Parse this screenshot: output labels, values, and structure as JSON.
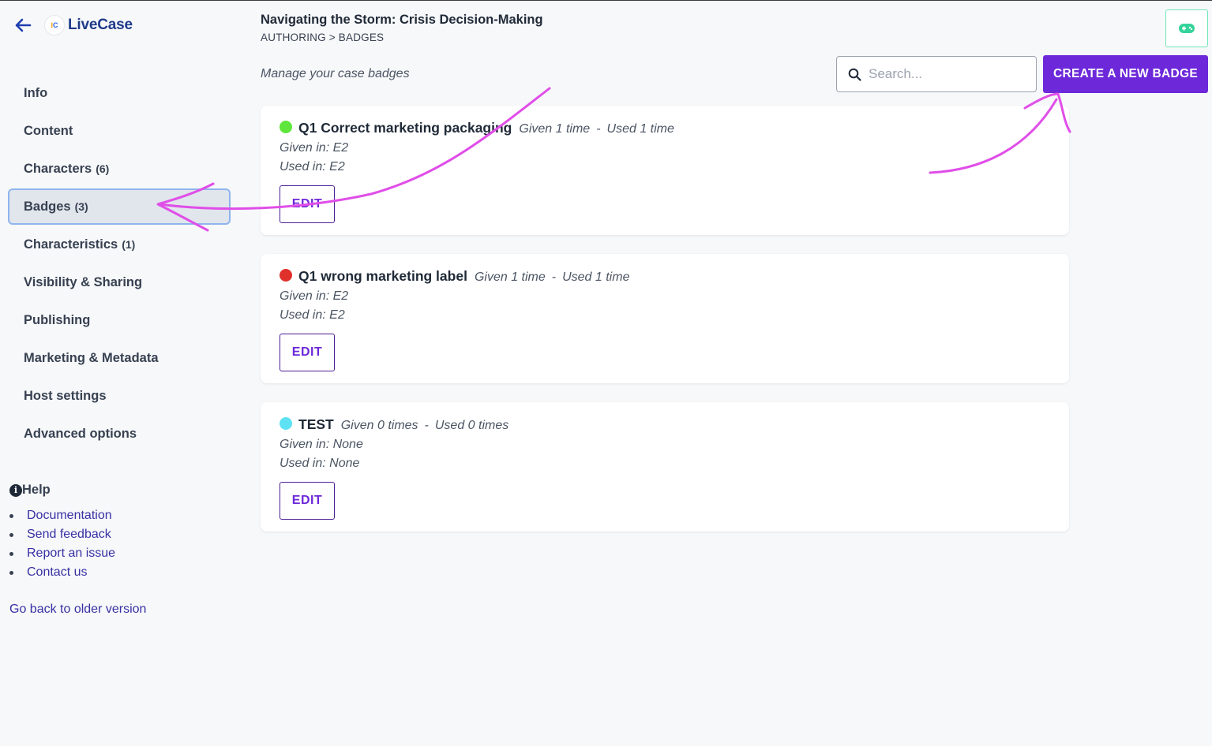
{
  "app": {
    "name": "LiveCase",
    "logo_text": "IC"
  },
  "header": {
    "title": "Navigating the Storm: Crisis Decision-Making",
    "breadcrumb": "AUTHORING > BADGES",
    "subtitle": "Manage your case badges",
    "search_placeholder": "Search...",
    "create_label": "CREATE A NEW BADGE"
  },
  "sidebar": {
    "items": [
      {
        "label": "Info",
        "count": ""
      },
      {
        "label": "Content",
        "count": ""
      },
      {
        "label": "Characters",
        "count": "(6)"
      },
      {
        "label": "Badges",
        "count": "(3)",
        "active": true
      },
      {
        "label": "Characteristics",
        "count": "(1)"
      },
      {
        "label": "Visibility & Sharing",
        "count": ""
      },
      {
        "label": "Publishing",
        "count": ""
      },
      {
        "label": "Marketing & Metadata",
        "count": ""
      },
      {
        "label": "Host settings",
        "count": ""
      },
      {
        "label": "Advanced options",
        "count": ""
      }
    ],
    "help": {
      "title": "Help",
      "links": [
        "Documentation",
        "Send feedback",
        "Report an issue",
        "Contact us"
      ]
    },
    "older_version": "Go back to older version"
  },
  "badges": [
    {
      "name": "Q1 Correct marketing packaging",
      "color": "#5fe63c",
      "given": "Given 1 time",
      "used": "Used 1 time",
      "given_in": "Given in: E2",
      "used_in": "Used in: E2",
      "edit_label": "EDIT"
    },
    {
      "name": "Q1 wrong marketing label",
      "color": "#e0302b",
      "given": "Given 1 time",
      "used": "Used 1 time",
      "given_in": "Given in: E2",
      "used_in": "Used in: E2",
      "edit_label": "EDIT"
    },
    {
      "name": "TEST",
      "color": "#5ee1f2",
      "given": "Given 0 times",
      "used": "Used 0 times",
      "given_in": "Given in: None",
      "used_in": "Used in: None",
      "edit_label": "EDIT"
    }
  ],
  "stat_separator": "-",
  "colors": {
    "accent": "#6d28d9",
    "annotation": "#e04ee8",
    "game_icon": "#34d399"
  },
  "icons": {
    "back": "arrow-left-icon",
    "search": "search-icon",
    "game": "gamepad-icon",
    "help": "info-icon"
  }
}
